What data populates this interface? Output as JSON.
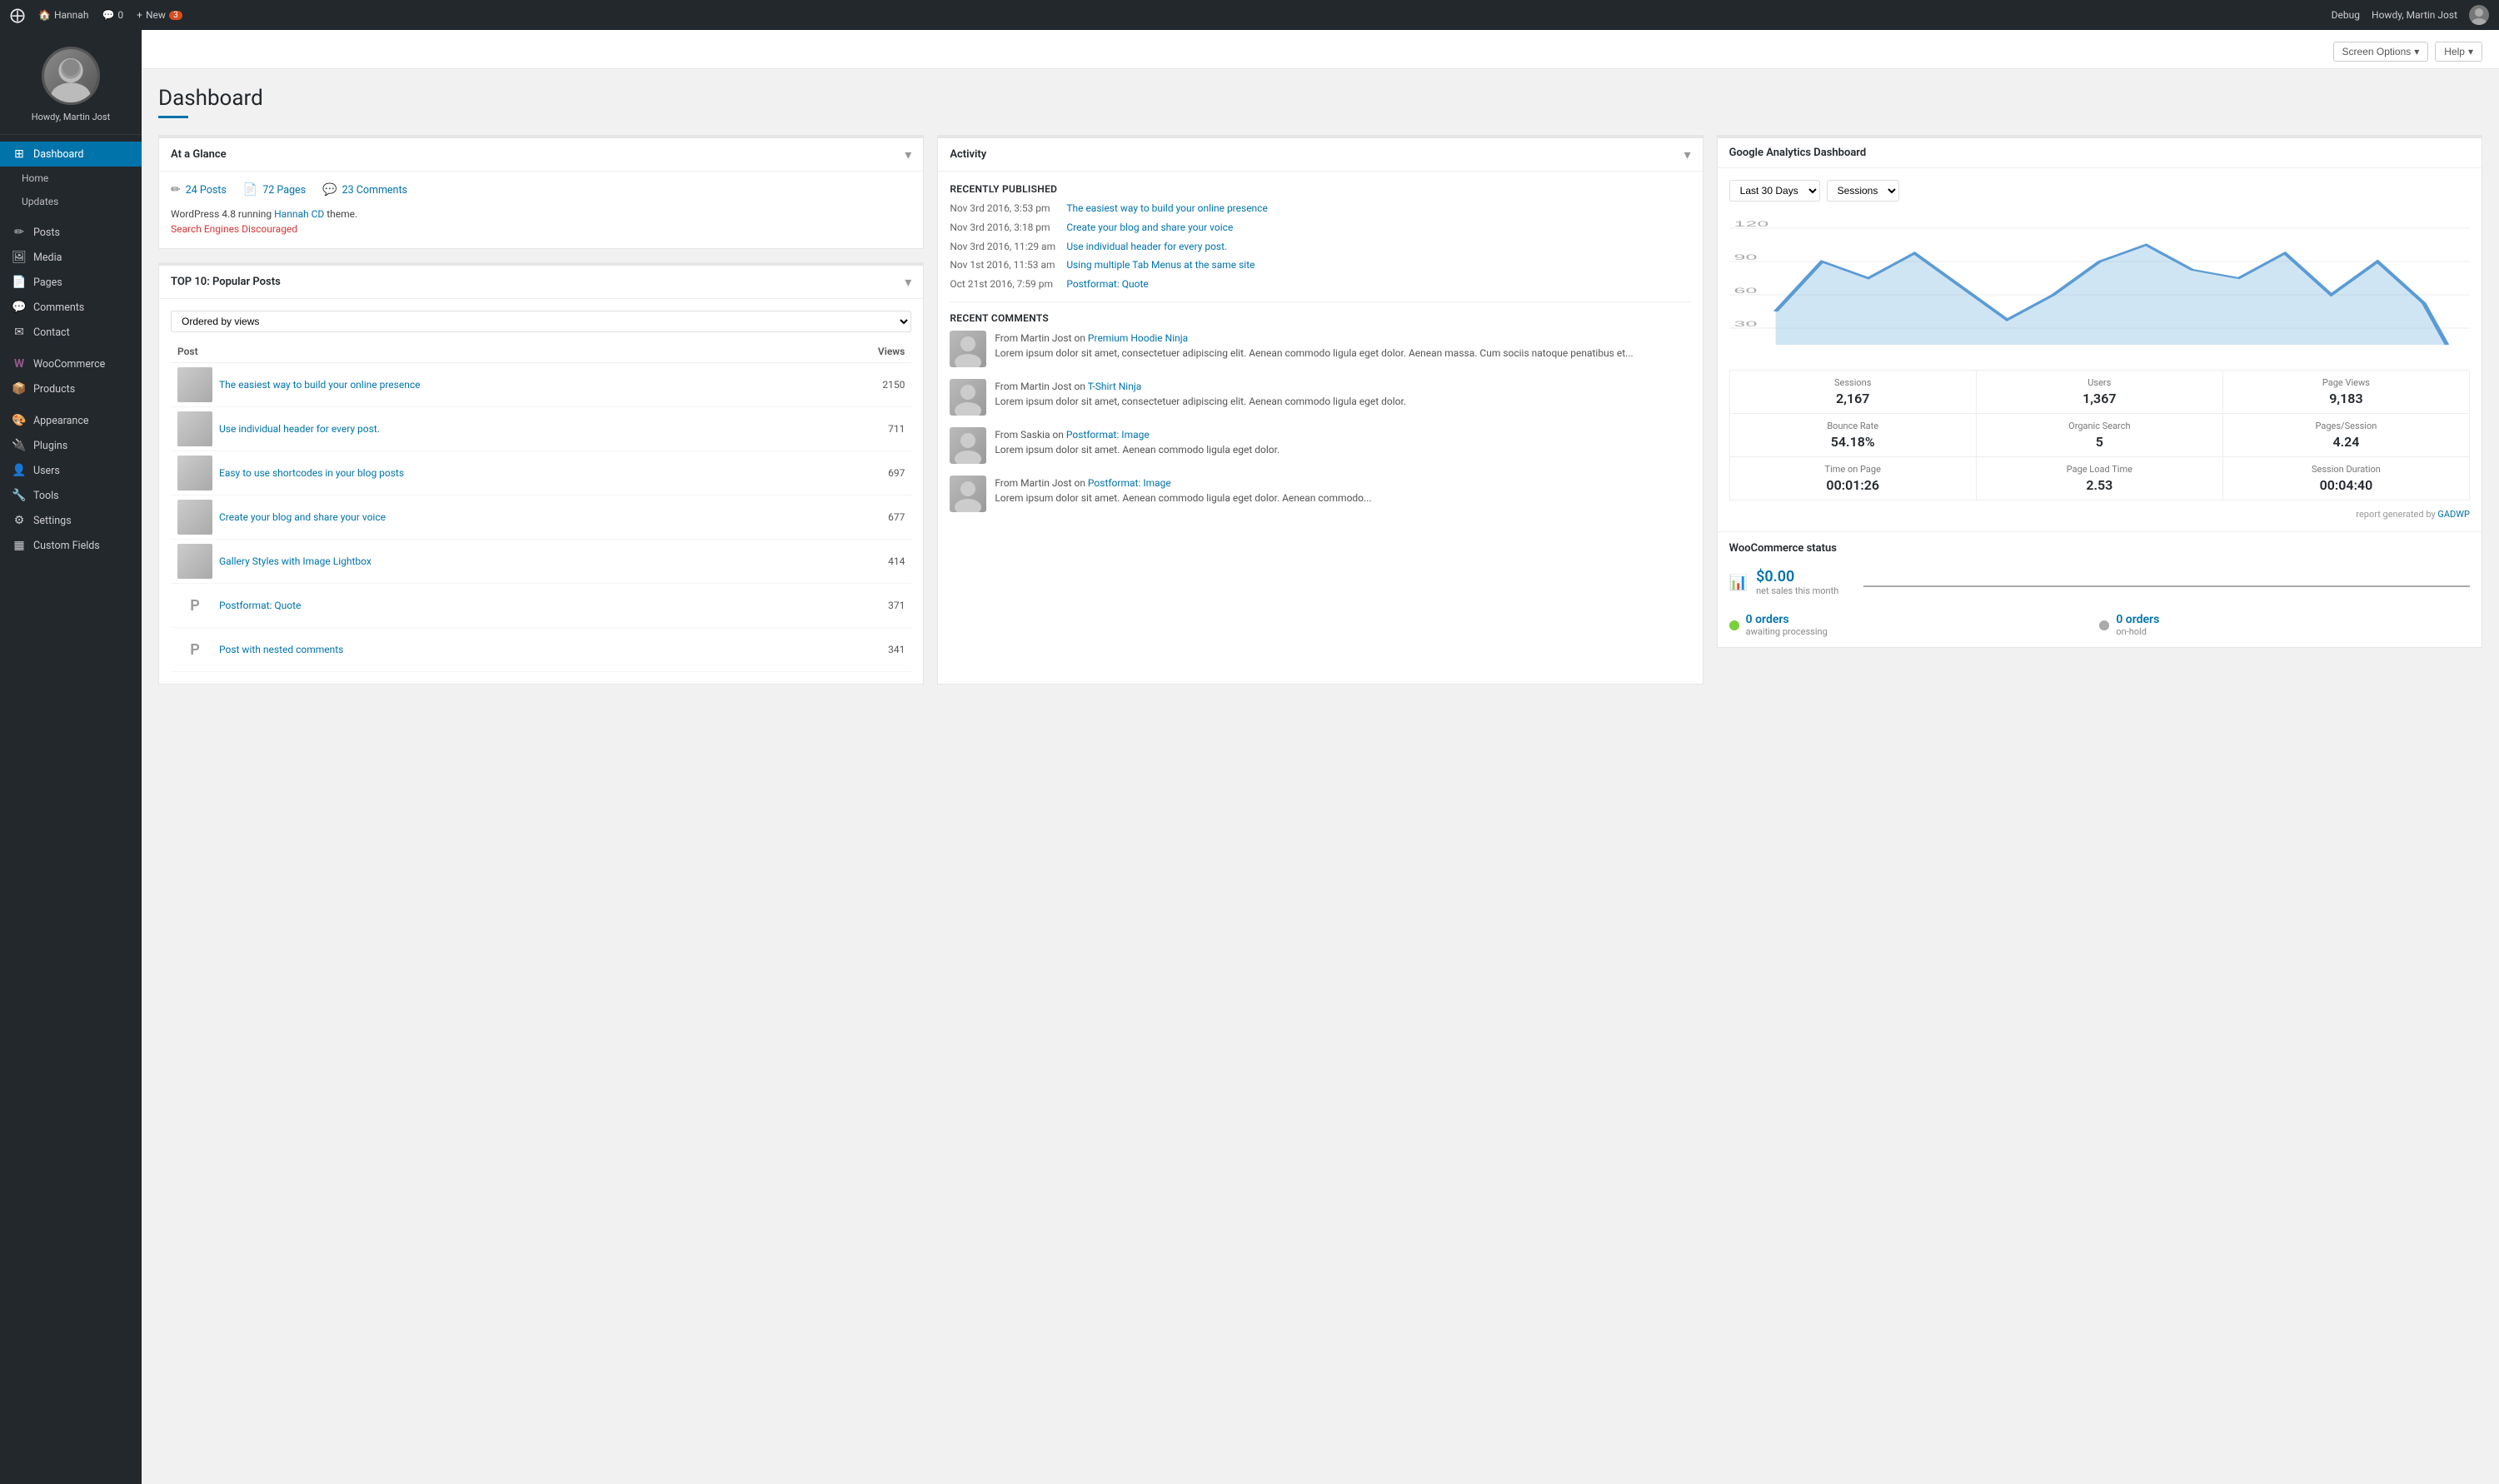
{
  "adminbar": {
    "logo": "⊞",
    "site_name": "Hannah",
    "comments_label": "0",
    "new_label": "New",
    "new_badge": "3",
    "debug_label": "Debug",
    "howdy_label": "Howdy, Martin Jost"
  },
  "header": {
    "screen_options": "Screen Options",
    "help": "Help"
  },
  "sidebar": {
    "username": "Howdy, Martin Jost",
    "nav_items": [
      {
        "id": "dashboard",
        "label": "Dashboard",
        "icon": "⊞",
        "active": true
      },
      {
        "id": "home",
        "label": "Home",
        "sub": true
      },
      {
        "id": "updates",
        "label": "Updates",
        "sub": true
      },
      {
        "id": "posts",
        "label": "Posts",
        "icon": "✏"
      },
      {
        "id": "media",
        "label": "Media",
        "icon": "🖼"
      },
      {
        "id": "pages",
        "label": "Pages",
        "icon": "📄"
      },
      {
        "id": "comments",
        "label": "Comments",
        "icon": "💬"
      },
      {
        "id": "contact",
        "label": "Contact",
        "icon": "✉"
      },
      {
        "id": "woocommerce",
        "label": "WooCommerce",
        "icon": "W"
      },
      {
        "id": "products",
        "label": "Products",
        "icon": "📦"
      },
      {
        "id": "appearance",
        "label": "Appearance",
        "icon": "🎨"
      },
      {
        "id": "plugins",
        "label": "Plugins",
        "icon": "🔌"
      },
      {
        "id": "users",
        "label": "Users",
        "icon": "👤"
      },
      {
        "id": "tools",
        "label": "Tools",
        "icon": "🔧"
      },
      {
        "id": "settings",
        "label": "Settings",
        "icon": "⚙"
      },
      {
        "id": "custom-fields",
        "label": "Custom Fields",
        "icon": "▦"
      }
    ]
  },
  "page_title": "Dashboard",
  "at_a_glance": {
    "title": "At a Glance",
    "posts_count": "24 Posts",
    "pages_count": "72 Pages",
    "comments_count": "23 Comments",
    "wp_info": "WordPress 4.8 running",
    "theme_link": "Hannah CD",
    "theme_suffix": "theme.",
    "discouraged": "Search Engines Discouraged"
  },
  "top_posts": {
    "title": "TOP 10: Popular Posts",
    "select_label": "Ordered by views",
    "col_post": "Post",
    "col_views": "Views",
    "posts": [
      {
        "title": "The easiest way to build your online presence",
        "views": "2150",
        "has_thumb": true
      },
      {
        "title": "Use individual header for every post.",
        "views": "711",
        "has_thumb": true
      },
      {
        "title": "Easy to use shortcodes in your blog posts",
        "views": "697",
        "has_thumb": true
      },
      {
        "title": "Create your blog and share your voice",
        "views": "677",
        "has_thumb": true
      },
      {
        "title": "Gallery Styles with Image Lightbox",
        "views": "414",
        "has_thumb": true
      },
      {
        "title": "Postformat: Quote",
        "views": "371",
        "has_thumb": false,
        "letter": "P"
      },
      {
        "title": "Post with nested comments",
        "views": "341",
        "has_thumb": false,
        "letter": "P"
      }
    ]
  },
  "activity": {
    "title": "Activity",
    "recently_published_label": "Recently Published",
    "items": [
      {
        "date": "Nov 3rd 2016, 3:53 pm",
        "title": "The easiest way to build your online presence"
      },
      {
        "date": "Nov 3rd 2016, 3:18 pm",
        "title": "Create your blog and share your voice"
      },
      {
        "date": "Nov 3rd 2016, 11:29 am",
        "title": "Use individual header for every post."
      },
      {
        "date": "Nov 1st 2016, 11:53 am",
        "title": "Using multiple Tab Menus at the same site"
      },
      {
        "date": "Oct 21st 2016, 7:59 pm",
        "title": "Postformat: Quote"
      }
    ],
    "recent_comments_label": "Recent Comments",
    "comments": [
      {
        "from": "From Martin Jost on",
        "post_link": "Premium Hoodie Ninja",
        "text": "Lorem ipsum dolor sit amet, consectetuer adipiscing elit. Aenean commodo ligula eget dolor. Aenean massa. Cum sociis natoque penatibus et..."
      },
      {
        "from": "From Martin Jost on",
        "post_link": "T-Shirt Ninja",
        "text": "Lorem ipsum dolor sit amet, consectetuer adipiscing elit. Aenean commodo ligula eget dolor."
      },
      {
        "from": "From Saskia on",
        "post_link": "Postformat: Image",
        "text": "Lorem ipsum dolor sit amet. Aenean commodo ligula eget dolor."
      },
      {
        "from": "From Martin Jost on",
        "post_link": "Postformat: Image",
        "text": "Lorem ipsum dolor sit amet. Aenean commodo ligula eget dolor. Aenean commodo..."
      }
    ]
  },
  "google_analytics": {
    "title": "Google Analytics Dashboard",
    "period_label": "Last 30 Days",
    "metric_label": "Sessions",
    "y_max": "120",
    "y_mid": "90",
    "y_low": "60",
    "y_min": "30",
    "stats": [
      {
        "label": "Sessions",
        "value": "2,167"
      },
      {
        "label": "Users",
        "value": "1,367"
      },
      {
        "label": "Page Views",
        "value": "9,183"
      },
      {
        "label": "Bounce Rate",
        "value": "54.18%"
      },
      {
        "label": "Organic Search",
        "value": "5"
      },
      {
        "label": "Pages/Session",
        "value": "4.24"
      },
      {
        "label": "Time on Page",
        "value": "00:01:26"
      },
      {
        "label": "Page Load Time",
        "value": "2.53"
      },
      {
        "label": "Session Duration",
        "value": "00:04:40"
      }
    ],
    "footer": "report generated by",
    "footer_link": "GADWP"
  },
  "woocommerce_status": {
    "title": "WooCommerce status",
    "sales_amount": "$0.00",
    "sales_label": "net sales this month",
    "orders": [
      {
        "count": "0 orders",
        "label": "awaiting processing",
        "color": "green"
      },
      {
        "count": "0 orders",
        "label": "on-hold",
        "color": "gray"
      }
    ]
  }
}
